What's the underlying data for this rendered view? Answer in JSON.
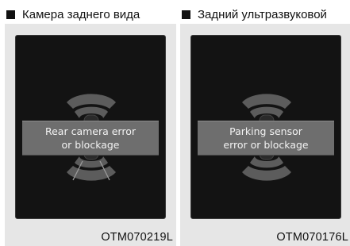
{
  "panels": [
    {
      "heading": "Камера заднего вида",
      "message_line1": "Rear camera error",
      "message_line2": "or blockage",
      "figure_code": "OTM070219L"
    },
    {
      "heading": "Задний ультразвуковой датчик",
      "message_line1": "Parking sensor",
      "message_line2": "error or blockage",
      "figure_code": "OTM070176L"
    }
  ],
  "colors": {
    "screen_background": "#131313",
    "banner": "#6e6e6e",
    "sensor_arcs": "#5c5c5c",
    "frame": "#e6e6e6"
  }
}
